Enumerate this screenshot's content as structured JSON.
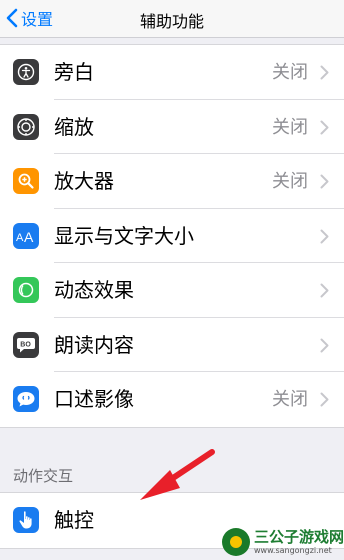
{
  "navbar": {
    "back_label": "设置",
    "title": "辅助功能"
  },
  "group1": [
    {
      "label": "旁白",
      "value": "关闭",
      "icon": "voiceover-icon",
      "color": "#3a3a3c"
    },
    {
      "label": "缩放",
      "value": "关闭",
      "icon": "zoom-icon",
      "color": "#3a3a3c"
    },
    {
      "label": "放大器",
      "value": "关闭",
      "icon": "magnifier-icon",
      "color": "#ff9500"
    },
    {
      "label": "显示与文字大小",
      "value": "",
      "icon": "text-size-icon",
      "color": "#1a7cf0"
    },
    {
      "label": "动态效果",
      "value": "",
      "icon": "motion-icon",
      "color": "#34c759"
    },
    {
      "label": "朗读内容",
      "value": "",
      "icon": "spoken-content-icon",
      "color": "#3a3a3c"
    },
    {
      "label": "口述影像",
      "value": "关闭",
      "icon": "audio-description-icon",
      "color": "#1a7cf0"
    }
  ],
  "section2": {
    "header": "动作交互",
    "rows": [
      {
        "label": "触控",
        "value": "",
        "icon": "touch-icon",
        "color": "#1a7cf0"
      }
    ]
  },
  "watermark": {
    "name": "三公子游戏网",
    "url": "www.sangongzi.net"
  }
}
